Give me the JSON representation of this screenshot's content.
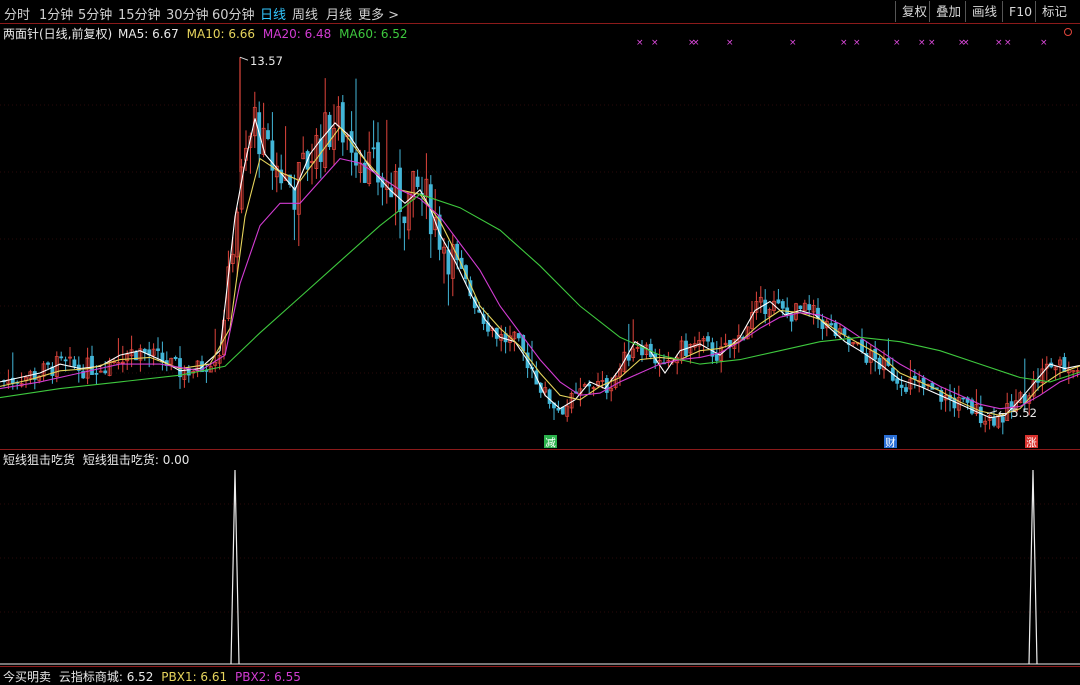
{
  "toolbar": {
    "periods": [
      {
        "label": "分时"
      },
      {
        "label": "1分钟"
      },
      {
        "label": "5分钟"
      },
      {
        "label": "15分钟"
      },
      {
        "label": "30分钟"
      },
      {
        "label": "60分钟"
      },
      {
        "label": "日线",
        "active": true
      },
      {
        "label": "周线"
      },
      {
        "label": "月线"
      },
      {
        "label": "更多 >"
      }
    ],
    "buttons": [
      {
        "label": "复权"
      },
      {
        "label": "叠加"
      },
      {
        "label": "画线"
      },
      {
        "label": "F10"
      },
      {
        "label": "标记"
      }
    ]
  },
  "main_legend": {
    "title": "两面针(日线,前复权)",
    "ma5": "MA5: 6.67",
    "ma10": "MA10: 6.66",
    "ma20": "MA20: 6.48",
    "ma60": "MA60: 6.52"
  },
  "annotations": {
    "high": "13.57",
    "low": "5.52"
  },
  "markers": [
    {
      "text": "减",
      "color": "#2bb24c"
    },
    {
      "text": "财",
      "color": "#2a6fd6"
    },
    {
      "text": "涨",
      "color": "#d8322e"
    }
  ],
  "sub_legend": {
    "name": "短线狙击吃货",
    "value": "短线狙击吃货: 0.00"
  },
  "bottom_legend": {
    "prefix": "今买明卖",
    "store": "云指标商城: 6.52",
    "pbx1": "PBX1: 6.61",
    "pbx2": "PBX2: 6.55"
  },
  "chart_data": {
    "type": "candlestick",
    "ylim": [
      5.0,
      14.0
    ],
    "price_high": 13.57,
    "price_low": 5.52,
    "ma_lines": [
      {
        "name": "MA5",
        "color": "#ffffff",
        "points": [
          [
            0,
            6.3
          ],
          [
            20,
            6.4
          ],
          [
            40,
            6.5
          ],
          [
            60,
            6.7
          ],
          [
            80,
            6.6
          ],
          [
            100,
            6.65
          ],
          [
            120,
            6.9
          ],
          [
            140,
            7.0
          ],
          [
            160,
            6.8
          ],
          [
            180,
            6.55
          ],
          [
            200,
            6.6
          ],
          [
            220,
            7.0
          ],
          [
            235,
            10.0
          ],
          [
            245,
            11.2
          ],
          [
            255,
            12.2
          ],
          [
            265,
            11.4
          ],
          [
            280,
            11.0
          ],
          [
            295,
            10.6
          ],
          [
            310,
            11.4
          ],
          [
            320,
            11.7
          ],
          [
            335,
            12.1
          ],
          [
            350,
            11.8
          ],
          [
            370,
            11.1
          ],
          [
            390,
            10.6
          ],
          [
            405,
            10.3
          ],
          [
            420,
            10.6
          ],
          [
            430,
            10.2
          ],
          [
            440,
            9.6
          ],
          [
            455,
            9.0
          ],
          [
            470,
            8.3
          ],
          [
            485,
            7.7
          ],
          [
            500,
            7.3
          ],
          [
            515,
            7.2
          ],
          [
            530,
            6.7
          ],
          [
            545,
            6.0
          ],
          [
            560,
            5.7
          ],
          [
            575,
            5.9
          ],
          [
            590,
            6.3
          ],
          [
            605,
            6.15
          ],
          [
            620,
            6.6
          ],
          [
            635,
            7.2
          ],
          [
            650,
            7.0
          ],
          [
            665,
            6.5
          ],
          [
            680,
            7.0
          ],
          [
            700,
            7.15
          ],
          [
            720,
            6.9
          ],
          [
            740,
            7.3
          ],
          [
            755,
            7.9
          ],
          [
            770,
            8.1
          ],
          [
            785,
            7.8
          ],
          [
            800,
            7.9
          ],
          [
            815,
            7.8
          ],
          [
            830,
            7.5
          ],
          [
            845,
            7.2
          ],
          [
            860,
            7.0
          ],
          [
            880,
            6.7
          ],
          [
            900,
            6.35
          ],
          [
            920,
            6.2
          ],
          [
            940,
            6.0
          ],
          [
            960,
            5.8
          ],
          [
            975,
            5.65
          ],
          [
            990,
            5.5
          ],
          [
            1005,
            5.55
          ],
          [
            1020,
            5.9
          ],
          [
            1035,
            6.3
          ],
          [
            1050,
            6.7
          ],
          [
            1065,
            6.6
          ],
          [
            1080,
            6.67
          ]
        ]
      },
      {
        "name": "MA10",
        "color": "#e6d45c",
        "points": [
          [
            0,
            6.2
          ],
          [
            30,
            6.35
          ],
          [
            60,
            6.55
          ],
          [
            90,
            6.6
          ],
          [
            120,
            6.8
          ],
          [
            150,
            6.85
          ],
          [
            180,
            6.6
          ],
          [
            210,
            6.7
          ],
          [
            230,
            7.5
          ],
          [
            245,
            10.0
          ],
          [
            260,
            11.3
          ],
          [
            280,
            11.0
          ],
          [
            300,
            10.8
          ],
          [
            320,
            11.4
          ],
          [
            340,
            12.0
          ],
          [
            360,
            11.4
          ],
          [
            380,
            10.9
          ],
          [
            400,
            10.6
          ],
          [
            420,
            10.5
          ],
          [
            440,
            9.9
          ],
          [
            460,
            9.0
          ],
          [
            480,
            8.0
          ],
          [
            500,
            7.5
          ],
          [
            520,
            7.1
          ],
          [
            540,
            6.5
          ],
          [
            560,
            6.0
          ],
          [
            580,
            5.9
          ],
          [
            600,
            6.2
          ],
          [
            620,
            6.4
          ],
          [
            640,
            6.8
          ],
          [
            660,
            6.85
          ],
          [
            680,
            6.8
          ],
          [
            700,
            7.0
          ],
          [
            720,
            7.05
          ],
          [
            740,
            7.2
          ],
          [
            760,
            7.6
          ],
          [
            780,
            7.9
          ],
          [
            800,
            7.85
          ],
          [
            820,
            7.7
          ],
          [
            840,
            7.4
          ],
          [
            860,
            7.15
          ],
          [
            880,
            6.9
          ],
          [
            900,
            6.5
          ],
          [
            920,
            6.3
          ],
          [
            940,
            6.1
          ],
          [
            960,
            5.85
          ],
          [
            980,
            5.65
          ],
          [
            1000,
            5.55
          ],
          [
            1020,
            5.7
          ],
          [
            1040,
            6.2
          ],
          [
            1060,
            6.5
          ],
          [
            1080,
            6.66
          ]
        ]
      },
      {
        "name": "MA20",
        "color": "#d23cd2",
        "points": [
          [
            0,
            6.15
          ],
          [
            40,
            6.3
          ],
          [
            80,
            6.5
          ],
          [
            120,
            6.7
          ],
          [
            160,
            6.7
          ],
          [
            200,
            6.55
          ],
          [
            225,
            6.9
          ],
          [
            240,
            8.5
          ],
          [
            260,
            9.8
          ],
          [
            280,
            10.3
          ],
          [
            300,
            10.3
          ],
          [
            320,
            10.8
          ],
          [
            340,
            11.3
          ],
          [
            360,
            11.2
          ],
          [
            380,
            10.9
          ],
          [
            400,
            10.6
          ],
          [
            420,
            10.4
          ],
          [
            440,
            10.0
          ],
          [
            460,
            9.4
          ],
          [
            480,
            8.8
          ],
          [
            500,
            8.0
          ],
          [
            520,
            7.4
          ],
          [
            540,
            6.8
          ],
          [
            560,
            6.3
          ],
          [
            580,
            6.0
          ],
          [
            600,
            6.05
          ],
          [
            620,
            6.3
          ],
          [
            640,
            6.5
          ],
          [
            660,
            6.7
          ],
          [
            680,
            6.8
          ],
          [
            700,
            6.85
          ],
          [
            720,
            6.95
          ],
          [
            740,
            7.2
          ],
          [
            760,
            7.5
          ],
          [
            780,
            7.75
          ],
          [
            800,
            7.85
          ],
          [
            820,
            7.8
          ],
          [
            840,
            7.6
          ],
          [
            860,
            7.3
          ],
          [
            880,
            7.0
          ],
          [
            900,
            6.7
          ],
          [
            920,
            6.45
          ],
          [
            940,
            6.2
          ],
          [
            960,
            6.0
          ],
          [
            980,
            5.8
          ],
          [
            1000,
            5.7
          ],
          [
            1020,
            5.75
          ],
          [
            1040,
            6.0
          ],
          [
            1060,
            6.3
          ],
          [
            1080,
            6.48
          ]
        ]
      },
      {
        "name": "MA60",
        "color": "#3ec83e",
        "points": [
          [
            0,
            5.95
          ],
          [
            60,
            6.15
          ],
          [
            120,
            6.3
          ],
          [
            180,
            6.45
          ],
          [
            225,
            6.65
          ],
          [
            260,
            7.4
          ],
          [
            300,
            8.2
          ],
          [
            340,
            9.0
          ],
          [
            380,
            9.8
          ],
          [
            420,
            10.5
          ],
          [
            460,
            10.2
          ],
          [
            500,
            9.7
          ],
          [
            540,
            8.9
          ],
          [
            580,
            8.0
          ],
          [
            620,
            7.3
          ],
          [
            660,
            6.9
          ],
          [
            700,
            6.7
          ],
          [
            740,
            6.8
          ],
          [
            780,
            7.0
          ],
          [
            820,
            7.2
          ],
          [
            860,
            7.3
          ],
          [
            900,
            7.2
          ],
          [
            940,
            7.0
          ],
          [
            980,
            6.7
          ],
          [
            1020,
            6.4
          ],
          [
            1050,
            6.3
          ],
          [
            1080,
            6.52
          ]
        ]
      }
    ],
    "sub_series": {
      "name": "短线狙击吃货",
      "ylim": [
        0,
        1
      ],
      "spikes": [
        235,
        1033
      ],
      "value": 0.0
    }
  }
}
